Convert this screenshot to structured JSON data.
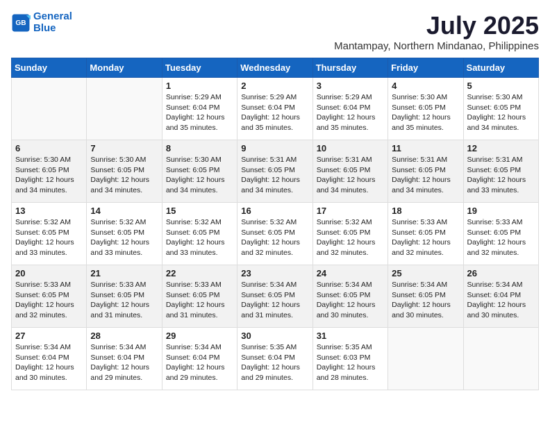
{
  "logo": {
    "line1": "General",
    "line2": "Blue"
  },
  "title": "July 2025",
  "subtitle": "Mantampay, Northern Mindanao, Philippines",
  "weekdays": [
    "Sunday",
    "Monday",
    "Tuesday",
    "Wednesday",
    "Thursday",
    "Friday",
    "Saturday"
  ],
  "weeks": [
    [
      {
        "day": "",
        "info": ""
      },
      {
        "day": "",
        "info": ""
      },
      {
        "day": "1",
        "info": "Sunrise: 5:29 AM\nSunset: 6:04 PM\nDaylight: 12 hours and 35 minutes."
      },
      {
        "day": "2",
        "info": "Sunrise: 5:29 AM\nSunset: 6:04 PM\nDaylight: 12 hours and 35 minutes."
      },
      {
        "day": "3",
        "info": "Sunrise: 5:29 AM\nSunset: 6:04 PM\nDaylight: 12 hours and 35 minutes."
      },
      {
        "day": "4",
        "info": "Sunrise: 5:30 AM\nSunset: 6:05 PM\nDaylight: 12 hours and 35 minutes."
      },
      {
        "day": "5",
        "info": "Sunrise: 5:30 AM\nSunset: 6:05 PM\nDaylight: 12 hours and 34 minutes."
      }
    ],
    [
      {
        "day": "6",
        "info": "Sunrise: 5:30 AM\nSunset: 6:05 PM\nDaylight: 12 hours and 34 minutes."
      },
      {
        "day": "7",
        "info": "Sunrise: 5:30 AM\nSunset: 6:05 PM\nDaylight: 12 hours and 34 minutes."
      },
      {
        "day": "8",
        "info": "Sunrise: 5:30 AM\nSunset: 6:05 PM\nDaylight: 12 hours and 34 minutes."
      },
      {
        "day": "9",
        "info": "Sunrise: 5:31 AM\nSunset: 6:05 PM\nDaylight: 12 hours and 34 minutes."
      },
      {
        "day": "10",
        "info": "Sunrise: 5:31 AM\nSunset: 6:05 PM\nDaylight: 12 hours and 34 minutes."
      },
      {
        "day": "11",
        "info": "Sunrise: 5:31 AM\nSunset: 6:05 PM\nDaylight: 12 hours and 34 minutes."
      },
      {
        "day": "12",
        "info": "Sunrise: 5:31 AM\nSunset: 6:05 PM\nDaylight: 12 hours and 33 minutes."
      }
    ],
    [
      {
        "day": "13",
        "info": "Sunrise: 5:32 AM\nSunset: 6:05 PM\nDaylight: 12 hours and 33 minutes."
      },
      {
        "day": "14",
        "info": "Sunrise: 5:32 AM\nSunset: 6:05 PM\nDaylight: 12 hours and 33 minutes."
      },
      {
        "day": "15",
        "info": "Sunrise: 5:32 AM\nSunset: 6:05 PM\nDaylight: 12 hours and 33 minutes."
      },
      {
        "day": "16",
        "info": "Sunrise: 5:32 AM\nSunset: 6:05 PM\nDaylight: 12 hours and 32 minutes."
      },
      {
        "day": "17",
        "info": "Sunrise: 5:32 AM\nSunset: 6:05 PM\nDaylight: 12 hours and 32 minutes."
      },
      {
        "day": "18",
        "info": "Sunrise: 5:33 AM\nSunset: 6:05 PM\nDaylight: 12 hours and 32 minutes."
      },
      {
        "day": "19",
        "info": "Sunrise: 5:33 AM\nSunset: 6:05 PM\nDaylight: 12 hours and 32 minutes."
      }
    ],
    [
      {
        "day": "20",
        "info": "Sunrise: 5:33 AM\nSunset: 6:05 PM\nDaylight: 12 hours and 32 minutes."
      },
      {
        "day": "21",
        "info": "Sunrise: 5:33 AM\nSunset: 6:05 PM\nDaylight: 12 hours and 31 minutes."
      },
      {
        "day": "22",
        "info": "Sunrise: 5:33 AM\nSunset: 6:05 PM\nDaylight: 12 hours and 31 minutes."
      },
      {
        "day": "23",
        "info": "Sunrise: 5:34 AM\nSunset: 6:05 PM\nDaylight: 12 hours and 31 minutes."
      },
      {
        "day": "24",
        "info": "Sunrise: 5:34 AM\nSunset: 6:05 PM\nDaylight: 12 hours and 30 minutes."
      },
      {
        "day": "25",
        "info": "Sunrise: 5:34 AM\nSunset: 6:05 PM\nDaylight: 12 hours and 30 minutes."
      },
      {
        "day": "26",
        "info": "Sunrise: 5:34 AM\nSunset: 6:04 PM\nDaylight: 12 hours and 30 minutes."
      }
    ],
    [
      {
        "day": "27",
        "info": "Sunrise: 5:34 AM\nSunset: 6:04 PM\nDaylight: 12 hours and 30 minutes."
      },
      {
        "day": "28",
        "info": "Sunrise: 5:34 AM\nSunset: 6:04 PM\nDaylight: 12 hours and 29 minutes."
      },
      {
        "day": "29",
        "info": "Sunrise: 5:34 AM\nSunset: 6:04 PM\nDaylight: 12 hours and 29 minutes."
      },
      {
        "day": "30",
        "info": "Sunrise: 5:35 AM\nSunset: 6:04 PM\nDaylight: 12 hours and 29 minutes."
      },
      {
        "day": "31",
        "info": "Sunrise: 5:35 AM\nSunset: 6:03 PM\nDaylight: 12 hours and 28 minutes."
      },
      {
        "day": "",
        "info": ""
      },
      {
        "day": "",
        "info": ""
      }
    ]
  ]
}
